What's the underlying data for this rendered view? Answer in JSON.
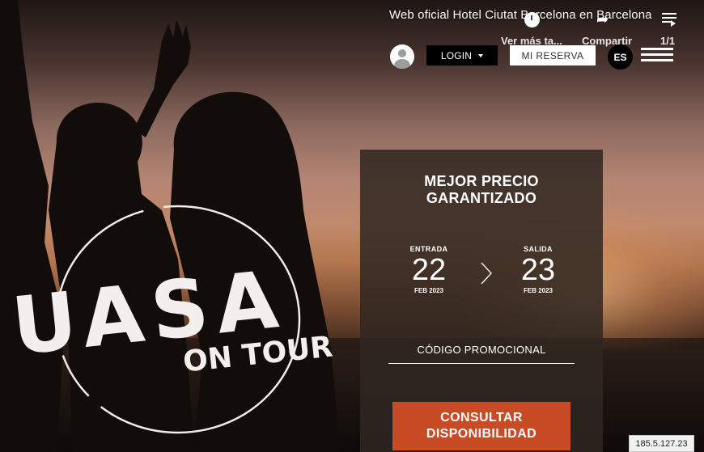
{
  "youtube": {
    "title": "Web oficial Hotel Ciutat Barcelona en Barcelona",
    "watch_later_label": "Ver más ta...",
    "share_label": "Compartir",
    "playlist_counter": "1/1"
  },
  "header": {
    "login_label": "LOGIN",
    "reservation_label": "MI RESERVA",
    "language": "ES"
  },
  "booking": {
    "headline_line1": "MEJOR PRECIO",
    "headline_line2": "GARANTIZADO",
    "checkin": {
      "label": "ENTRADA",
      "day": "22",
      "month": "FEB 2023"
    },
    "checkout": {
      "label": "SALIDA",
      "day": "23",
      "month": "FEB 2023"
    },
    "promo_label": "CÓDIGO PROMOCIONAL",
    "cta_line1": "CONSULTAR",
    "cta_line2": "DISPONIBILIDAD"
  },
  "logo": {
    "text_main": "UASA",
    "text_sub": "ON TOUR"
  },
  "ip_address": "185.5.127.23",
  "colors": {
    "cta": "#c84b26",
    "panel": "#302621"
  }
}
